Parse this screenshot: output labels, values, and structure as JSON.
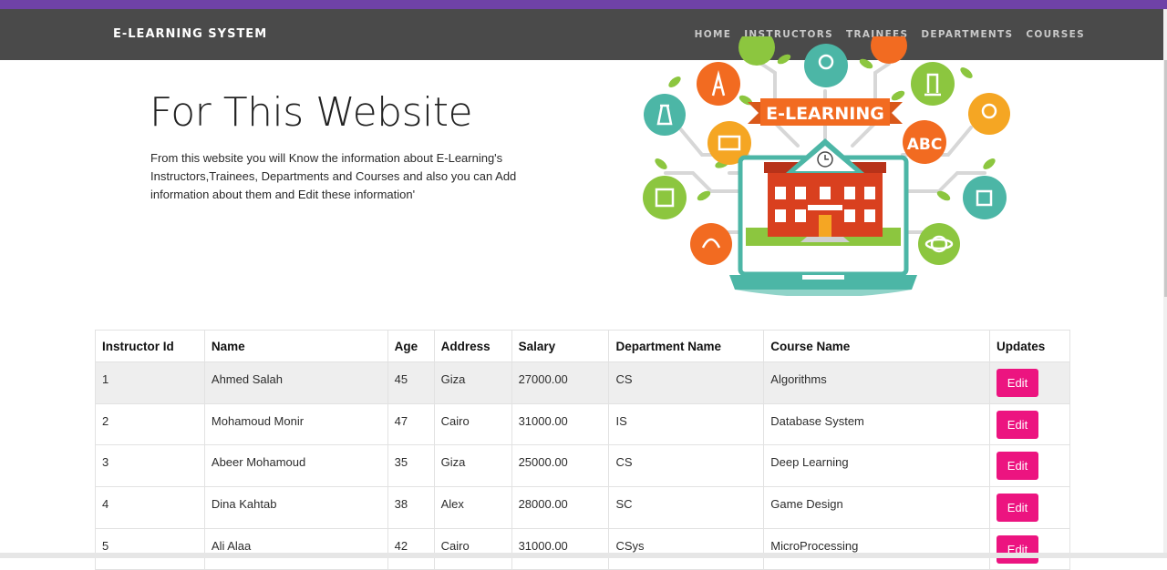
{
  "nav": {
    "brand": "E-LEARNING SYSTEM",
    "links": [
      "HOME",
      "INSTRUCTORS",
      "TRAINEES",
      "DEPARTMENTS",
      "COURSES"
    ]
  },
  "hero": {
    "title": "For This Website",
    "description": "From this website you will Know the information about E-Learning's Instructors,Trainees, Departments and Courses and also you can Add information about them and Edit these information'",
    "banner_text": "E-LEARNING"
  },
  "table": {
    "headers": [
      "Instructor Id",
      "Name",
      "Age",
      "Address",
      "Salary",
      "Department Name",
      "Course Name",
      "Updates"
    ],
    "rows": [
      {
        "id": "1",
        "name": "Ahmed Salah",
        "age": "45",
        "address": "Giza",
        "salary": "27000.00",
        "department": "CS",
        "course": "Algorithms",
        "action": "Edit"
      },
      {
        "id": "2",
        "name": "Mohamoud Monir",
        "age": "47",
        "address": "Cairo",
        "salary": "31000.00",
        "department": "IS",
        "course": "Database System",
        "action": "Edit"
      },
      {
        "id": "3",
        "name": "Abeer Mohamoud",
        "age": "35",
        "address": "Giza",
        "salary": "25000.00",
        "department": "CS",
        "course": "Deep Learning",
        "action": "Edit"
      },
      {
        "id": "4",
        "name": "Dina Kahtab",
        "age": "38",
        "address": "Alex",
        "salary": "28000.00",
        "department": "SC",
        "course": "Game Design",
        "action": "Edit"
      },
      {
        "id": "5",
        "name": "Ali Alaa",
        "age": "42",
        "address": "Cairo",
        "salary": "31000.00",
        "department": "CSys",
        "course": "MicroProcessing",
        "action": "Edit"
      }
    ]
  },
  "colors": {
    "accent_bar": "#6f42a7",
    "navbar": "#4a4a4a",
    "edit_button": "#ec1480"
  }
}
